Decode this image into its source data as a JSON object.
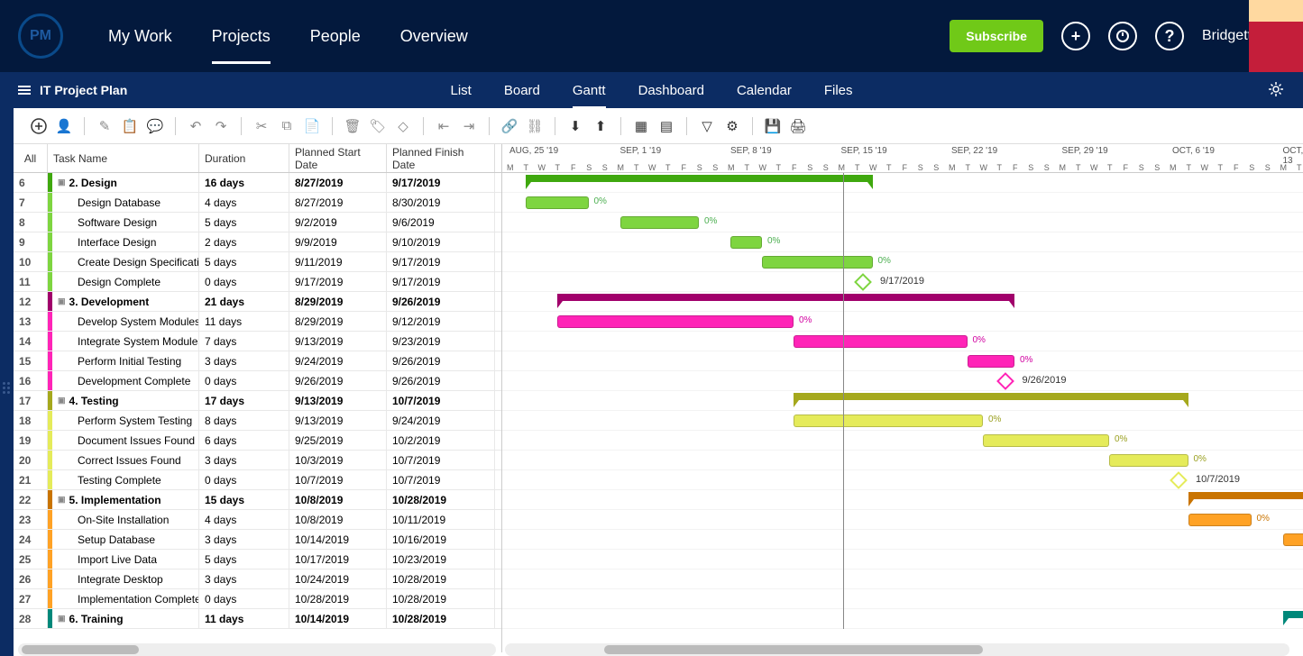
{
  "header": {
    "logo": "PM",
    "nav": [
      "My Work",
      "Projects",
      "People",
      "Overview"
    ],
    "active_nav": 1,
    "subscribe": "Subscribe",
    "username": "Bridgette"
  },
  "subnav": {
    "title": "IT Project Plan",
    "tabs": [
      "List",
      "Board",
      "Gantt",
      "Dashboard",
      "Calendar",
      "Files"
    ],
    "active_tab": 2
  },
  "table": {
    "headers": {
      "all": "All",
      "name": "Task Name",
      "duration": "Duration",
      "start": "Planned Start Date",
      "finish": "Planned Finish Date"
    },
    "rows": [
      {
        "num": "6",
        "color": "#3fa80e",
        "name": "2. Design",
        "dur": "16 days",
        "start": "8/27/2019",
        "finish": "9/17/2019",
        "summary": true
      },
      {
        "num": "7",
        "color": "#7ed540",
        "name": "Design Database",
        "dur": "4 days",
        "start": "8/27/2019",
        "finish": "8/30/2019"
      },
      {
        "num": "8",
        "color": "#7ed540",
        "name": "Software Design",
        "dur": "5 days",
        "start": "9/2/2019",
        "finish": "9/6/2019"
      },
      {
        "num": "9",
        "color": "#7ed540",
        "name": "Interface Design",
        "dur": "2 days",
        "start": "9/9/2019",
        "finish": "9/10/2019"
      },
      {
        "num": "10",
        "color": "#7ed540",
        "name": "Create Design Specification",
        "dur": "5 days",
        "start": "9/11/2019",
        "finish": "9/17/2019"
      },
      {
        "num": "11",
        "color": "#7ed540",
        "name": "Design Complete",
        "dur": "0 days",
        "start": "9/17/2019",
        "finish": "9/17/2019",
        "milestone": true,
        "mlabel": "9/17/2019"
      },
      {
        "num": "12",
        "color": "#a1006b",
        "name": "3. Development",
        "dur": "21 days",
        "start": "8/29/2019",
        "finish": "9/26/2019",
        "summary": true
      },
      {
        "num": "13",
        "color": "#ff24b7",
        "name": "Develop System Modules",
        "dur": "11 days",
        "start": "8/29/2019",
        "finish": "9/12/2019"
      },
      {
        "num": "14",
        "color": "#ff24b7",
        "name": "Integrate System Modules",
        "dur": "7 days",
        "start": "9/13/2019",
        "finish": "9/23/2019"
      },
      {
        "num": "15",
        "color": "#ff24b7",
        "name": "Perform Initial Testing",
        "dur": "3 days",
        "start": "9/24/2019",
        "finish": "9/26/2019"
      },
      {
        "num": "16",
        "color": "#ff24b7",
        "name": "Development Complete",
        "dur": "0 days",
        "start": "9/26/2019",
        "finish": "9/26/2019",
        "milestone": true,
        "mlabel": "9/26/2019"
      },
      {
        "num": "17",
        "color": "#a5a81c",
        "name": "4. Testing",
        "dur": "17 days",
        "start": "9/13/2019",
        "finish": "10/7/2019",
        "summary": true
      },
      {
        "num": "18",
        "color": "#e5eb5a",
        "name": "Perform System Testing",
        "dur": "8 days",
        "start": "9/13/2019",
        "finish": "9/24/2019"
      },
      {
        "num": "19",
        "color": "#e5eb5a",
        "name": "Document Issues Found",
        "dur": "6 days",
        "start": "9/25/2019",
        "finish": "10/2/2019"
      },
      {
        "num": "20",
        "color": "#e5eb5a",
        "name": "Correct Issues Found",
        "dur": "3 days",
        "start": "10/3/2019",
        "finish": "10/7/2019"
      },
      {
        "num": "21",
        "color": "#e5eb5a",
        "name": "Testing Complete",
        "dur": "0 days",
        "start": "10/7/2019",
        "finish": "10/7/2019",
        "milestone": true,
        "mlabel": "10/7/2019"
      },
      {
        "num": "22",
        "color": "#c97400",
        "name": "5. Implementation",
        "dur": "15 days",
        "start": "10/8/2019",
        "finish": "10/28/2019",
        "summary": true
      },
      {
        "num": "23",
        "color": "#ffa225",
        "name": "On-Site Installation",
        "dur": "4 days",
        "start": "10/8/2019",
        "finish": "10/11/2019"
      },
      {
        "num": "24",
        "color": "#ffa225",
        "name": "Setup Database",
        "dur": "3 days",
        "start": "10/14/2019",
        "finish": "10/16/2019"
      },
      {
        "num": "25",
        "color": "#ffa225",
        "name": "Import Live Data",
        "dur": "5 days",
        "start": "10/17/2019",
        "finish": "10/23/2019"
      },
      {
        "num": "26",
        "color": "#ffa225",
        "name": "Integrate Desktop",
        "dur": "3 days",
        "start": "10/24/2019",
        "finish": "10/28/2019"
      },
      {
        "num": "27",
        "color": "#ffa225",
        "name": "Implementation Complete",
        "dur": "0 days",
        "start": "10/28/2019",
        "finish": "10/28/2019"
      },
      {
        "num": "28",
        "color": "#00887a",
        "name": "6. Training",
        "dur": "11 days",
        "start": "10/14/2019",
        "finish": "10/28/2019",
        "summary": true
      }
    ]
  },
  "timeline": {
    "weeks": [
      "AUG, 25 '19",
      "SEP, 1 '19",
      "SEP, 8 '19",
      "SEP, 15 '19",
      "SEP, 22 '19",
      "SEP, 29 '19",
      "OCT, 6 '19",
      "OCT, 13"
    ],
    "days_pattern": [
      "M",
      "T",
      "W",
      "T",
      "F",
      "S",
      "S"
    ],
    "day_width": 17.5,
    "start_day_offset": 0
  },
  "chart_data": {
    "type": "gantt",
    "title": "IT Project Plan — Gantt",
    "time_axis": {
      "start": "2019-08-25",
      "end": "2019-10-15",
      "unit": "day"
    },
    "tasks": [
      {
        "id": 6,
        "name": "2. Design",
        "type": "summary",
        "start": "2019-08-27",
        "end": "2019-09-17",
        "color": "#3fa80e"
      },
      {
        "id": 7,
        "name": "Design Database",
        "type": "task",
        "start": "2019-08-27",
        "end": "2019-08-30",
        "progress": 0,
        "color": "#7ed540"
      },
      {
        "id": 8,
        "name": "Software Design",
        "type": "task",
        "start": "2019-09-02",
        "end": "2019-09-06",
        "progress": 0,
        "color": "#7ed540"
      },
      {
        "id": 9,
        "name": "Interface Design",
        "type": "task",
        "start": "2019-09-09",
        "end": "2019-09-10",
        "progress": 0,
        "color": "#7ed540"
      },
      {
        "id": 10,
        "name": "Create Design Specification",
        "type": "task",
        "start": "2019-09-11",
        "end": "2019-09-17",
        "progress": 0,
        "color": "#7ed540"
      },
      {
        "id": 11,
        "name": "Design Complete",
        "type": "milestone",
        "date": "2019-09-17",
        "color": "#7ed540"
      },
      {
        "id": 12,
        "name": "3. Development",
        "type": "summary",
        "start": "2019-08-29",
        "end": "2019-09-26",
        "color": "#a1006b"
      },
      {
        "id": 13,
        "name": "Develop System Modules",
        "type": "task",
        "start": "2019-08-29",
        "end": "2019-09-12",
        "progress": 0,
        "color": "#ff24b7"
      },
      {
        "id": 14,
        "name": "Integrate System Modules",
        "type": "task",
        "start": "2019-09-13",
        "end": "2019-09-23",
        "progress": 0,
        "color": "#ff24b7"
      },
      {
        "id": 15,
        "name": "Perform Initial Testing",
        "type": "task",
        "start": "2019-09-24",
        "end": "2019-09-26",
        "progress": 0,
        "color": "#ff24b7"
      },
      {
        "id": 16,
        "name": "Development Complete",
        "type": "milestone",
        "date": "2019-09-26",
        "color": "#ff24b7"
      },
      {
        "id": 17,
        "name": "4. Testing",
        "type": "summary",
        "start": "2019-09-13",
        "end": "2019-10-07",
        "color": "#a5a81c"
      },
      {
        "id": 18,
        "name": "Perform System Testing",
        "type": "task",
        "start": "2019-09-13",
        "end": "2019-09-24",
        "progress": 0,
        "color": "#e5eb5a"
      },
      {
        "id": 19,
        "name": "Document Issues Found",
        "type": "task",
        "start": "2019-09-25",
        "end": "2019-10-02",
        "progress": 0,
        "color": "#e5eb5a"
      },
      {
        "id": 20,
        "name": "Correct Issues Found",
        "type": "task",
        "start": "2019-10-03",
        "end": "2019-10-07",
        "progress": 0,
        "color": "#e5eb5a"
      },
      {
        "id": 21,
        "name": "Testing Complete",
        "type": "milestone",
        "date": "2019-10-07",
        "color": "#e5eb5a"
      },
      {
        "id": 22,
        "name": "5. Implementation",
        "type": "summary",
        "start": "2019-10-08",
        "end": "2019-10-28",
        "color": "#c97400"
      },
      {
        "id": 23,
        "name": "On-Site Installation",
        "type": "task",
        "start": "2019-10-08",
        "end": "2019-10-11",
        "progress": 0,
        "color": "#ffa225"
      },
      {
        "id": 24,
        "name": "Setup Database",
        "type": "task",
        "start": "2019-10-14",
        "end": "2019-10-16",
        "progress": 0,
        "color": "#ffa225"
      },
      {
        "id": 25,
        "name": "Import Live Data",
        "type": "task",
        "start": "2019-10-17",
        "end": "2019-10-23",
        "color": "#ffa225"
      },
      {
        "id": 26,
        "name": "Integrate Desktop",
        "type": "task",
        "start": "2019-10-24",
        "end": "2019-10-28",
        "color": "#ffa225"
      },
      {
        "id": 27,
        "name": "Implementation Complete",
        "type": "milestone",
        "date": "2019-10-28",
        "color": "#ffa225"
      },
      {
        "id": 28,
        "name": "6. Training",
        "type": "summary",
        "start": "2019-10-14",
        "end": "2019-10-28",
        "color": "#00887a"
      }
    ]
  }
}
